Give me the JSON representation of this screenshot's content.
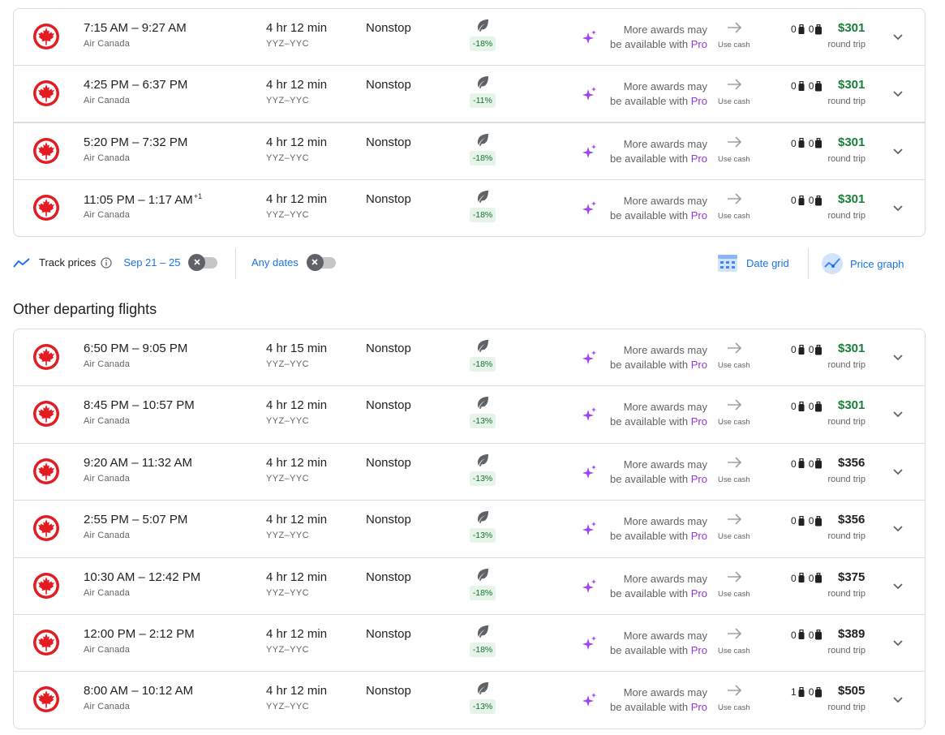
{
  "top_flights": [
    {
      "times": "7:15 AM – 9:27 AM",
      "day_offset": "",
      "airline": "Air Canada",
      "duration": "4 hr 12 min",
      "route": "YYZ–YYC",
      "stops": "Nonstop",
      "emissions": "-18%",
      "award_line1": "More awards may",
      "award_line2": "be available with",
      "award_pro": "Pro",
      "use_cash": "Use cash",
      "carry_on": "0",
      "checked": "0",
      "price": "$301",
      "price_low": true,
      "price_type": "round trip"
    },
    {
      "times": "4:25 PM – 6:37 PM",
      "day_offset": "",
      "airline": "Air Canada",
      "duration": "4 hr 12 min",
      "route": "YYZ–YYC",
      "stops": "Nonstop",
      "emissions": "-11%",
      "award_line1": "More awards may",
      "award_line2": "be available with",
      "award_pro": "Pro",
      "use_cash": "Use cash",
      "carry_on": "0",
      "checked": "0",
      "price": "$301",
      "price_low": true,
      "price_type": "round trip"
    },
    {
      "times": "5:20 PM – 7:32 PM",
      "day_offset": "",
      "airline": "Air Canada",
      "duration": "4 hr 12 min",
      "route": "YYZ–YYC",
      "stops": "Nonstop",
      "emissions": "-18%",
      "award_line1": "More awards may",
      "award_line2": "be available with",
      "award_pro": "Pro",
      "use_cash": "Use cash",
      "carry_on": "0",
      "checked": "0",
      "price": "$301",
      "price_low": true,
      "price_type": "round trip"
    },
    {
      "times": "11:05 PM – 1:17 AM",
      "day_offset": "+1",
      "airline": "Air Canada",
      "duration": "4 hr 12 min",
      "route": "YYZ–YYC",
      "stops": "Nonstop",
      "emissions": "-18%",
      "award_line1": "More awards may",
      "award_line2": "be available with",
      "award_pro": "Pro",
      "use_cash": "Use cash",
      "carry_on": "0",
      "checked": "0",
      "price": "$301",
      "price_low": true,
      "price_type": "round trip"
    }
  ],
  "toolbar": {
    "track_prices": "Track prices",
    "dates": "Sep 21 – 25",
    "any_dates": "Any dates",
    "date_grid": "Date grid",
    "price_graph": "Price graph"
  },
  "other_title": "Other departing flights",
  "other_flights": [
    {
      "times": "6:50 PM – 9:05 PM",
      "day_offset": "",
      "airline": "Air Canada",
      "duration": "4 hr 15 min",
      "route": "YYZ–YYC",
      "stops": "Nonstop",
      "emissions": "-18%",
      "award_line1": "More awards may",
      "award_line2": "be available with",
      "award_pro": "Pro",
      "use_cash": "Use cash",
      "carry_on": "0",
      "checked": "0",
      "price": "$301",
      "price_low": true,
      "price_type": "round trip"
    },
    {
      "times": "8:45 PM – 10:57 PM",
      "day_offset": "",
      "airline": "Air Canada",
      "duration": "4 hr 12 min",
      "route": "YYZ–YYC",
      "stops": "Nonstop",
      "emissions": "-13%",
      "award_line1": "More awards may",
      "award_line2": "be available with",
      "award_pro": "Pro",
      "use_cash": "Use cash",
      "carry_on": "0",
      "checked": "0",
      "price": "$301",
      "price_low": true,
      "price_type": "round trip"
    },
    {
      "times": "9:20 AM – 11:32 AM",
      "day_offset": "",
      "airline": "Air Canada",
      "duration": "4 hr 12 min",
      "route": "YYZ–YYC",
      "stops": "Nonstop",
      "emissions": "-13%",
      "award_line1": "More awards may",
      "award_line2": "be available with",
      "award_pro": "Pro",
      "use_cash": "Use cash",
      "carry_on": "0",
      "checked": "0",
      "price": "$356",
      "price_low": false,
      "price_type": "round trip"
    },
    {
      "times": "2:55 PM – 5:07 PM",
      "day_offset": "",
      "airline": "Air Canada",
      "duration": "4 hr 12 min",
      "route": "YYZ–YYC",
      "stops": "Nonstop",
      "emissions": "-13%",
      "award_line1": "More awards may",
      "award_line2": "be available with",
      "award_pro": "Pro",
      "use_cash": "Use cash",
      "carry_on": "0",
      "checked": "0",
      "price": "$356",
      "price_low": false,
      "price_type": "round trip"
    },
    {
      "times": "10:30 AM – 12:42 PM",
      "day_offset": "",
      "airline": "Air Canada",
      "duration": "4 hr 12 min",
      "route": "YYZ–YYC",
      "stops": "Nonstop",
      "emissions": "-18%",
      "award_line1": "More awards may",
      "award_line2": "be available with",
      "award_pro": "Pro",
      "use_cash": "Use cash",
      "carry_on": "0",
      "checked": "0",
      "price": "$375",
      "price_low": false,
      "price_type": "round trip"
    },
    {
      "times": "12:00 PM – 2:12 PM",
      "day_offset": "",
      "airline": "Air Canada",
      "duration": "4 hr 12 min",
      "route": "YYZ–YYC",
      "stops": "Nonstop",
      "emissions": "-18%",
      "award_line1": "More awards may",
      "award_line2": "be available with",
      "award_pro": "Pro",
      "use_cash": "Use cash",
      "carry_on": "0",
      "checked": "0",
      "price": "$389",
      "price_low": false,
      "price_type": "round trip"
    },
    {
      "times": "8:00 AM – 10:12 AM",
      "day_offset": "",
      "airline": "Air Canada",
      "duration": "4 hr 12 min",
      "route": "YYZ–YYC",
      "stops": "Nonstop",
      "emissions": "-13%",
      "award_line1": "More awards may",
      "award_line2": "be available with",
      "award_pro": "Pro",
      "use_cash": "Use cash",
      "carry_on": "1",
      "checked": "0",
      "price": "$505",
      "price_low": false,
      "price_type": "round trip"
    }
  ],
  "colors": {
    "price_low": "#188038",
    "pro": "#9334e6",
    "link": "#1a73e8",
    "emissions_bg": "#e6f4ea",
    "airline_red": "#e31c23"
  }
}
